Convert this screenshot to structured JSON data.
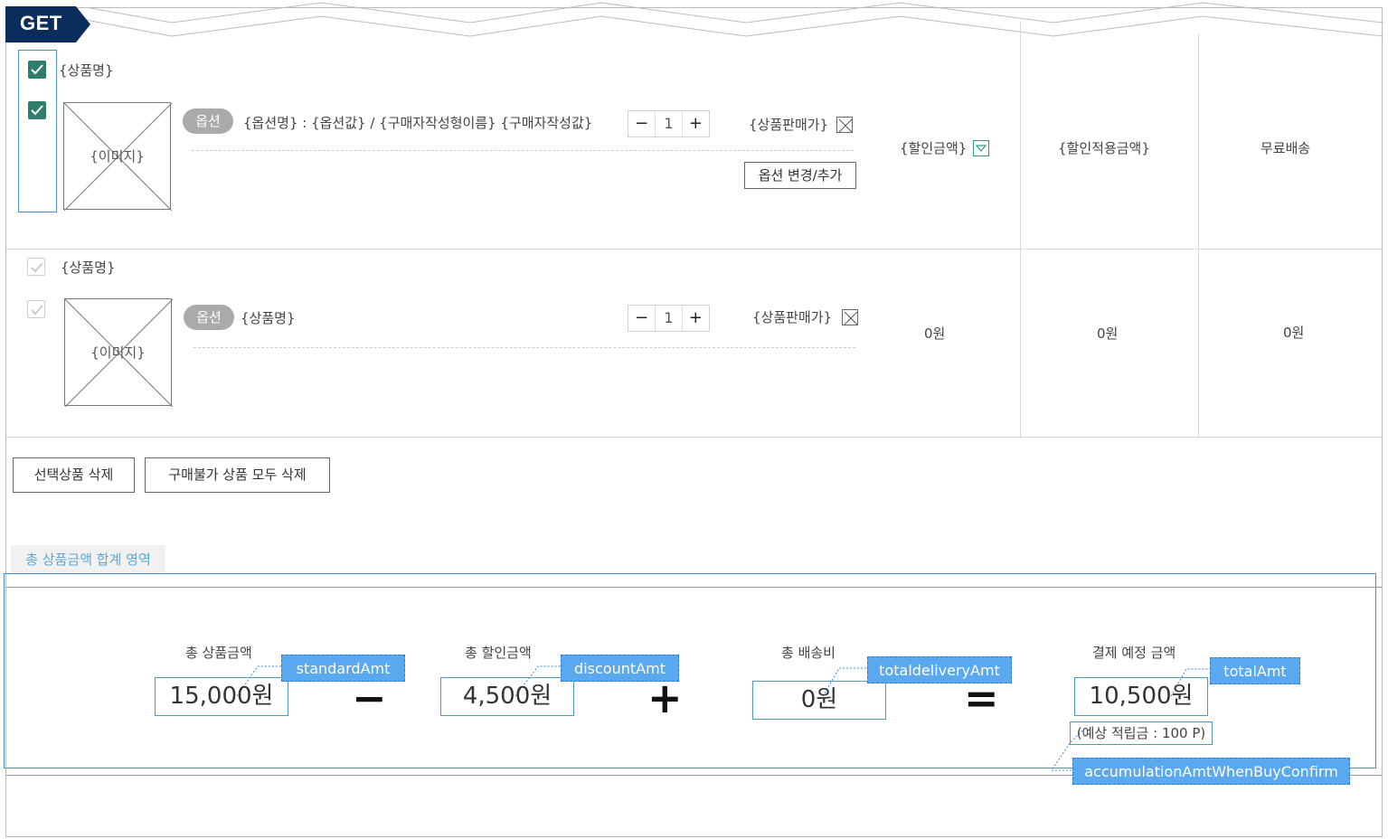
{
  "method_badge": "GET",
  "row1": {
    "product_name": "{상품명}",
    "image_label": "{이미지}",
    "option_pill": "옵션",
    "option_text": "{옵션명} : {옵션값} / {구매자작성형이름} {구매자작성값}",
    "qty_minus": "−",
    "qty_value": "1",
    "qty_plus": "+",
    "sale_price": "{상품판매가}",
    "change_button": "옵션 변경/추가",
    "discount_amount": "{할인금액}",
    "discounted_amount": "{할인적용금액}",
    "delivery": "무료배송"
  },
  "row2": {
    "product_name": "{상품명}",
    "image_label": "{이미지}",
    "option_pill": "옵션",
    "option_text": "{상품명}",
    "qty_minus": "−",
    "qty_value": "1",
    "qty_plus": "+",
    "sale_price": "{상품판매가}",
    "discount_amount": "0원",
    "discounted_amount": "0원",
    "delivery": "0원"
  },
  "actions": {
    "delete_selected": "선택상품 삭제",
    "delete_unavailable": "구매불가 상품 모두 삭제"
  },
  "summary": {
    "area_label": "총 상품금액 합계 영역",
    "total_product_label": "총 상품금액",
    "total_product_value": "15,000원",
    "total_product_tag": "standardAmt",
    "total_discount_label": "총 할인금액",
    "total_discount_value": "4,500원",
    "total_discount_tag": "discountAmt",
    "total_delivery_label": "총 배송비",
    "total_delivery_value": "0원",
    "total_delivery_tag": "totaldeliveryAmt",
    "payment_label": "결제 예정 금액",
    "payment_value": "10,500원",
    "payment_tag": "totalAmt",
    "accumulation_text": "(예상 적립금 :  100 P)",
    "accumulation_tag": "accumulationAmtWhenBuyConfirm",
    "op_minus": "−",
    "op_plus": "+",
    "op_equals": "="
  },
  "colors": {
    "badge": "#0b2d5c",
    "checkbox_on": "#2f7d6b",
    "tag": "#5aa8f0",
    "highlight": "#4a90c8"
  }
}
